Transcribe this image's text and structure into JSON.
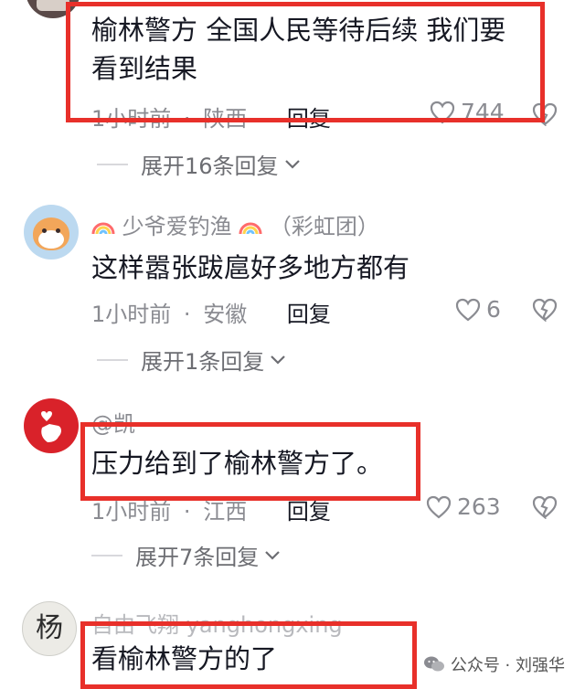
{
  "comments": [
    {
      "username": "",
      "text_line1": "榆林警方 全国人民等待后续 我们要",
      "text_line2": "看到结果",
      "time": "1小时前",
      "location": "陕西",
      "reply_label": "回复",
      "likes": "744",
      "expand_label": "展开16条回复"
    },
    {
      "username": "少爷爱钓渔",
      "badge": "（彩虹团）",
      "text": "这样嚣张跋扈好多地方都有",
      "time": "1小时前",
      "location": "安徽",
      "reply_label": "回复",
      "likes": "6",
      "expand_label": "展开1条回复"
    },
    {
      "username": "@凯",
      "text": "压力给到了榆林警方了。",
      "time": "1小时前",
      "location": "江西",
      "reply_label": "回复",
      "likes": "263",
      "expand_label": "展开7条回复"
    },
    {
      "username": "自由飞翔 yanghongxing",
      "avatar_text": "杨",
      "text": "看榆林警方的了"
    }
  ],
  "separator": "·",
  "watermark": {
    "label": "公众号 · 刘强华"
  },
  "colors": {
    "highlight_box": "#e8302a",
    "meta_gray": "#8a8b91",
    "text": "#161823"
  }
}
